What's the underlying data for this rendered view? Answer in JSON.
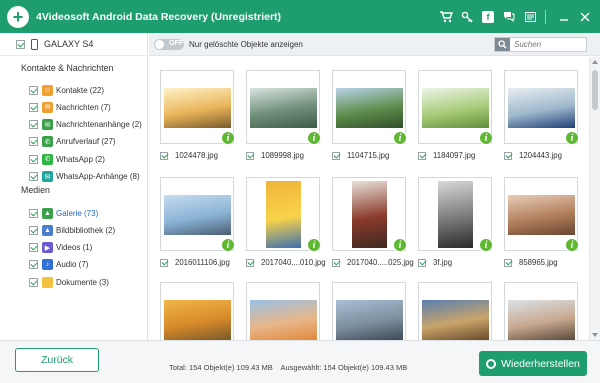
{
  "window": {
    "title": "4Videosoft Android Data Recovery (Unregistriert)",
    "logo_glyph": "+",
    "icons": [
      "cart-icon",
      "key-icon",
      "facebook-icon",
      "chat-icon",
      "menu-icon",
      "minimize-icon",
      "close-icon"
    ]
  },
  "sidebar": {
    "device": "GALAXY S4",
    "sections": [
      {
        "title": "Kontakte & Nachrichten",
        "items": [
          {
            "label": "Kontakte (22)",
            "icon": "contacts-icon",
            "color": "#f0a030",
            "glyph": "☺"
          },
          {
            "label": "Nachrichten (7)",
            "icon": "messages-icon",
            "color": "#f0a030",
            "glyph": "✉"
          },
          {
            "label": "Nachrichtenanhänge (2)",
            "icon": "attachments-icon",
            "color": "#3aa04a",
            "glyph": "✉"
          },
          {
            "label": "Anrufverlauf (27)",
            "icon": "call-log-icon",
            "color": "#3aa04a",
            "glyph": "✆"
          },
          {
            "label": "WhatsApp (2)",
            "icon": "whatsapp-icon",
            "color": "#2cb742",
            "glyph": "✆"
          },
          {
            "label": "WhatsApp-Anhänge (8)",
            "icon": "whatsapp-attachments-icon",
            "color": "#20a8a0",
            "glyph": "✉"
          }
        ]
      },
      {
        "title": "Medien",
        "items": [
          {
            "label": "Galerie (73)",
            "icon": "gallery-icon",
            "color": "#3aa04a",
            "glyph": "▲",
            "selected": true
          },
          {
            "label": "Bildbibliothek (2)",
            "icon": "image-library-icon",
            "color": "#4a7fd0",
            "glyph": "▲"
          },
          {
            "label": "Videos (1)",
            "icon": "videos-icon",
            "color": "#6a5ad0",
            "glyph": "▶"
          },
          {
            "label": "Audio (7)",
            "icon": "audio-icon",
            "color": "#2f6fd8",
            "glyph": "♪"
          },
          {
            "label": "Dokumente (3)",
            "icon": "documents-icon",
            "color": "#f3c23e",
            "glyph": ""
          }
        ]
      }
    ]
  },
  "toolbar": {
    "toggle_state": "OFF",
    "toggle_label": "Nur gelöschte Objekte anzeigen",
    "search_placeholder": "Suchen"
  },
  "gallery": {
    "info_glyph": "i",
    "items": [
      {
        "filename": "1024478.jpg",
        "colors": [
          "#fff2c8",
          "#e9b55a",
          "#7a5a2a"
        ]
      },
      {
        "filename": "1089998.jpg",
        "colors": [
          "#d9e4e0",
          "#6f8f7a",
          "#3d5a46"
        ]
      },
      {
        "filename": "1104715.jpg",
        "colors": [
          "#b8d2e8",
          "#5f8e4c",
          "#2f4d2a"
        ]
      },
      {
        "filename": "1184097.jpg",
        "colors": [
          "#eef4e8",
          "#a8cc7a",
          "#5f8e3a"
        ]
      },
      {
        "filename": "1204443.jpg",
        "colors": [
          "#e9eef2",
          "#9eb8cc",
          "#1f3e76"
        ]
      },
      {
        "filename": "2016011106.jpg",
        "colors": [
          "#c6dcef",
          "#8ab3d6",
          "#4a5e72"
        ]
      },
      {
        "filename": "2017040....010.jpg",
        "colors": [
          "#f0b43a",
          "#f7d34a",
          "#3f6fb0"
        ]
      },
      {
        "filename": "2017040.....025.jpg",
        "colors": [
          "#e8e2da",
          "#8a3a2a",
          "#3e2a22"
        ]
      },
      {
        "filename": "3f.jpg",
        "colors": [
          "#d8d8d8",
          "#7a7a7a",
          "#2a2a2a"
        ]
      },
      {
        "filename": "858965.jpg",
        "colors": [
          "#e8cdb8",
          "#b27f5c",
          "#6a4530"
        ]
      },
      {
        "filename": "",
        "colors": [
          "#f0b54a",
          "#d88a2a",
          "#7a5a2a"
        ]
      },
      {
        "filename": "",
        "colors": [
          "#9ac0e6",
          "#e8b68a",
          "#e0893a"
        ]
      },
      {
        "filename": "",
        "colors": [
          "#a9bfd4",
          "#7d8fa0",
          "#3d4a56"
        ]
      },
      {
        "filename": "",
        "colors": [
          "#5a7fb0",
          "#c9a46a",
          "#6a4a2a"
        ]
      },
      {
        "filename": "",
        "colors": [
          "#dce2e6",
          "#c8a890",
          "#5a4a3a"
        ]
      }
    ]
  },
  "footer": {
    "back_label": "Zurück",
    "total": "Total:  154 Objekt(e)  109.43 MB",
    "selected": "Ausgewählt:  154 Objekt(e)  109.43 MB",
    "recover_label": "Wiederherstellen"
  },
  "colors": {
    "brand": "#1e9e6f",
    "info_badge": "#5fb832"
  }
}
